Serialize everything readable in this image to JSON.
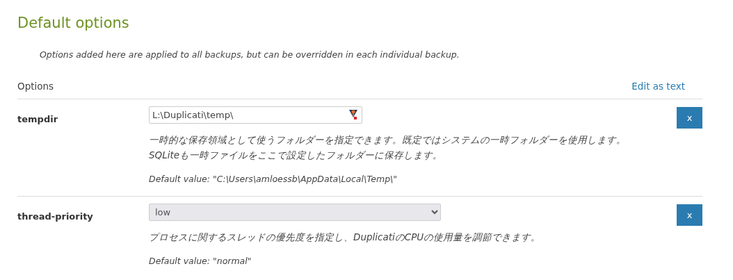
{
  "title": "Default options",
  "intro": "Options added here are applied to all backups, but can be overridden in each individual backup.",
  "header": {
    "label": "Options",
    "link": "Edit as text"
  },
  "options": [
    {
      "name": "tempdir",
      "kind": "text",
      "value": "L:\\Duplicati\\temp\\",
      "description": [
        "一時的な保存領域として使うフォルダーを指定できます。既定ではシステムの一時フォルダーを使用します。",
        "SQLiteも一時ファイルをここで設定したフォルダーに保存します。"
      ],
      "default": "Default value: \"C:\\Users\\amloessb\\AppData\\Local\\Temp\\\"",
      "remove": "x"
    },
    {
      "name": "thread-priority",
      "kind": "select",
      "value": "low",
      "description": [
        "プロセスに関するスレッドの優先度を指定し、DuplicatiのCPUの使用量を調節できます。"
      ],
      "default": "Default value: \"normal\"",
      "remove": "x"
    }
  ]
}
